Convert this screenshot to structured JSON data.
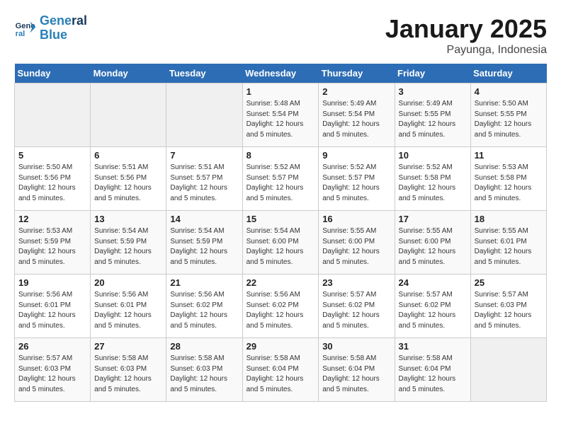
{
  "logo": {
    "line1": "General",
    "line2": "Blue"
  },
  "title": "January 2025",
  "subtitle": "Payunga, Indonesia",
  "days_of_week": [
    "Sunday",
    "Monday",
    "Tuesday",
    "Wednesday",
    "Thursday",
    "Friday",
    "Saturday"
  ],
  "weeks": [
    [
      {
        "day": "",
        "info": ""
      },
      {
        "day": "",
        "info": ""
      },
      {
        "day": "",
        "info": ""
      },
      {
        "day": "1",
        "info": "Sunrise: 5:48 AM\nSunset: 5:54 PM\nDaylight: 12 hours and 5 minutes."
      },
      {
        "day": "2",
        "info": "Sunrise: 5:49 AM\nSunset: 5:54 PM\nDaylight: 12 hours and 5 minutes."
      },
      {
        "day": "3",
        "info": "Sunrise: 5:49 AM\nSunset: 5:55 PM\nDaylight: 12 hours and 5 minutes."
      },
      {
        "day": "4",
        "info": "Sunrise: 5:50 AM\nSunset: 5:55 PM\nDaylight: 12 hours and 5 minutes."
      }
    ],
    [
      {
        "day": "5",
        "info": "Sunrise: 5:50 AM\nSunset: 5:56 PM\nDaylight: 12 hours and 5 minutes."
      },
      {
        "day": "6",
        "info": "Sunrise: 5:51 AM\nSunset: 5:56 PM\nDaylight: 12 hours and 5 minutes."
      },
      {
        "day": "7",
        "info": "Sunrise: 5:51 AM\nSunset: 5:57 PM\nDaylight: 12 hours and 5 minutes."
      },
      {
        "day": "8",
        "info": "Sunrise: 5:52 AM\nSunset: 5:57 PM\nDaylight: 12 hours and 5 minutes."
      },
      {
        "day": "9",
        "info": "Sunrise: 5:52 AM\nSunset: 5:57 PM\nDaylight: 12 hours and 5 minutes."
      },
      {
        "day": "10",
        "info": "Sunrise: 5:52 AM\nSunset: 5:58 PM\nDaylight: 12 hours and 5 minutes."
      },
      {
        "day": "11",
        "info": "Sunrise: 5:53 AM\nSunset: 5:58 PM\nDaylight: 12 hours and 5 minutes."
      }
    ],
    [
      {
        "day": "12",
        "info": "Sunrise: 5:53 AM\nSunset: 5:59 PM\nDaylight: 12 hours and 5 minutes."
      },
      {
        "day": "13",
        "info": "Sunrise: 5:54 AM\nSunset: 5:59 PM\nDaylight: 12 hours and 5 minutes."
      },
      {
        "day": "14",
        "info": "Sunrise: 5:54 AM\nSunset: 5:59 PM\nDaylight: 12 hours and 5 minutes."
      },
      {
        "day": "15",
        "info": "Sunrise: 5:54 AM\nSunset: 6:00 PM\nDaylight: 12 hours and 5 minutes."
      },
      {
        "day": "16",
        "info": "Sunrise: 5:55 AM\nSunset: 6:00 PM\nDaylight: 12 hours and 5 minutes."
      },
      {
        "day": "17",
        "info": "Sunrise: 5:55 AM\nSunset: 6:00 PM\nDaylight: 12 hours and 5 minutes."
      },
      {
        "day": "18",
        "info": "Sunrise: 5:55 AM\nSunset: 6:01 PM\nDaylight: 12 hours and 5 minutes."
      }
    ],
    [
      {
        "day": "19",
        "info": "Sunrise: 5:56 AM\nSunset: 6:01 PM\nDaylight: 12 hours and 5 minutes."
      },
      {
        "day": "20",
        "info": "Sunrise: 5:56 AM\nSunset: 6:01 PM\nDaylight: 12 hours and 5 minutes."
      },
      {
        "day": "21",
        "info": "Sunrise: 5:56 AM\nSunset: 6:02 PM\nDaylight: 12 hours and 5 minutes."
      },
      {
        "day": "22",
        "info": "Sunrise: 5:56 AM\nSunset: 6:02 PM\nDaylight: 12 hours and 5 minutes."
      },
      {
        "day": "23",
        "info": "Sunrise: 5:57 AM\nSunset: 6:02 PM\nDaylight: 12 hours and 5 minutes."
      },
      {
        "day": "24",
        "info": "Sunrise: 5:57 AM\nSunset: 6:02 PM\nDaylight: 12 hours and 5 minutes."
      },
      {
        "day": "25",
        "info": "Sunrise: 5:57 AM\nSunset: 6:03 PM\nDaylight: 12 hours and 5 minutes."
      }
    ],
    [
      {
        "day": "26",
        "info": "Sunrise: 5:57 AM\nSunset: 6:03 PM\nDaylight: 12 hours and 5 minutes."
      },
      {
        "day": "27",
        "info": "Sunrise: 5:58 AM\nSunset: 6:03 PM\nDaylight: 12 hours and 5 minutes."
      },
      {
        "day": "28",
        "info": "Sunrise: 5:58 AM\nSunset: 6:03 PM\nDaylight: 12 hours and 5 minutes."
      },
      {
        "day": "29",
        "info": "Sunrise: 5:58 AM\nSunset: 6:04 PM\nDaylight: 12 hours and 5 minutes."
      },
      {
        "day": "30",
        "info": "Sunrise: 5:58 AM\nSunset: 6:04 PM\nDaylight: 12 hours and 5 minutes."
      },
      {
        "day": "31",
        "info": "Sunrise: 5:58 AM\nSunset: 6:04 PM\nDaylight: 12 hours and 5 minutes."
      },
      {
        "day": "",
        "info": ""
      }
    ]
  ]
}
